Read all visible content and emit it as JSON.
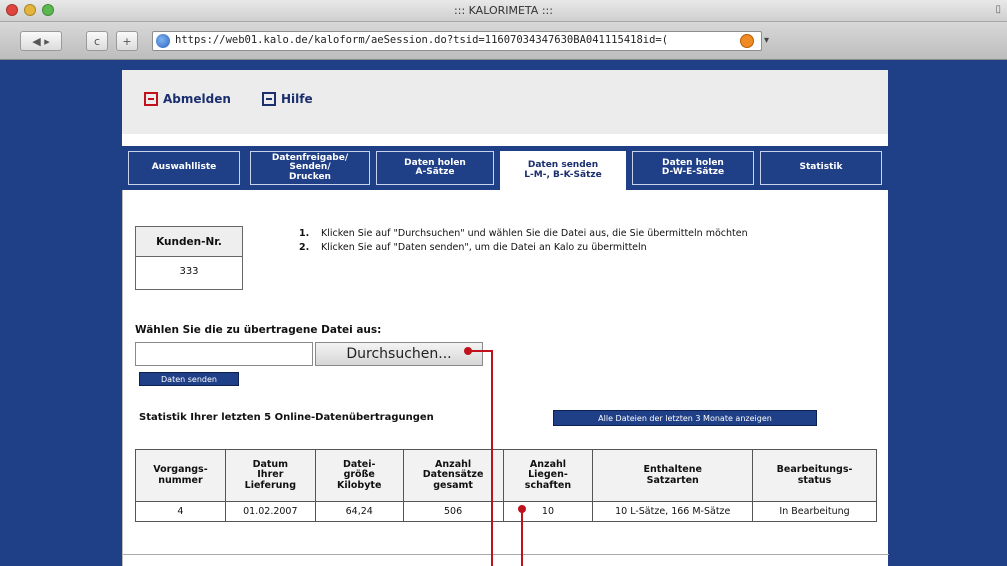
{
  "browser": {
    "window_title": "::: KALORIMETA :::",
    "url": "https://web01.kalo.de/kaloform/aeSession.do?tsid=11607034347630BA041115418id=(",
    "back_label": "◀ ▸",
    "reload_label": "c",
    "add_label": "+",
    "dropdown_glyph": "▾"
  },
  "top_links": {
    "logout": "Abmelden",
    "help": "Hilfe"
  },
  "tabs": [
    {
      "label": "Auswahlliste"
    },
    {
      "label": "Datenfreigabe/\nSenden/\nDrucken"
    },
    {
      "label": "Daten holen\nA-Sätze"
    },
    {
      "label": "Daten senden\nL-M-, B-K-Sätze"
    },
    {
      "label": "Daten holen\nD-W-E-Sätze"
    },
    {
      "label": "Statistik"
    }
  ],
  "customer": {
    "header": "Kunden-Nr.",
    "value": "333"
  },
  "steps": [
    {
      "num": "1.",
      "text": "Klicken Sie auf \"Durchsuchen\" und wählen Sie die Datei aus, die Sie übermitteln möchten"
    },
    {
      "num": "2.",
      "text": "Klicken Sie auf \"Daten senden\", um die Datei an Kalo zu übermitteln"
    }
  ],
  "upload": {
    "label": "Wählen Sie die zu übertragene Datei aus:",
    "file_value": "",
    "browse_label": "Durchsuchen...",
    "send_label": "Daten senden"
  },
  "stats": {
    "title": "Statistik Ihrer letzten 5 Online-Datenübertragungen",
    "all_files_label": "Alle Dateien der letzten 3 Monate anzeigen",
    "headers": [
      "Vorgangs-\nnummer",
      "Datum\nIhrer\nLieferung",
      "Datei-\ngröße\nKilobyte",
      "Anzahl\nDatensätze\ngesamt",
      "Anzahl\nLiegen-\nschaften",
      "Enthaltene\nSatzarten",
      "Bearbeitungs-\nstatus"
    ],
    "rows": [
      [
        "4",
        "01.02.2007",
        "64,24",
        "506",
        "10",
        "10 L-Sätze, 166 M-Sätze",
        "In Bearbeitung"
      ]
    ]
  },
  "colors": {
    "brand_blue": "#1f3f87",
    "callout_red": "#c0121c"
  }
}
